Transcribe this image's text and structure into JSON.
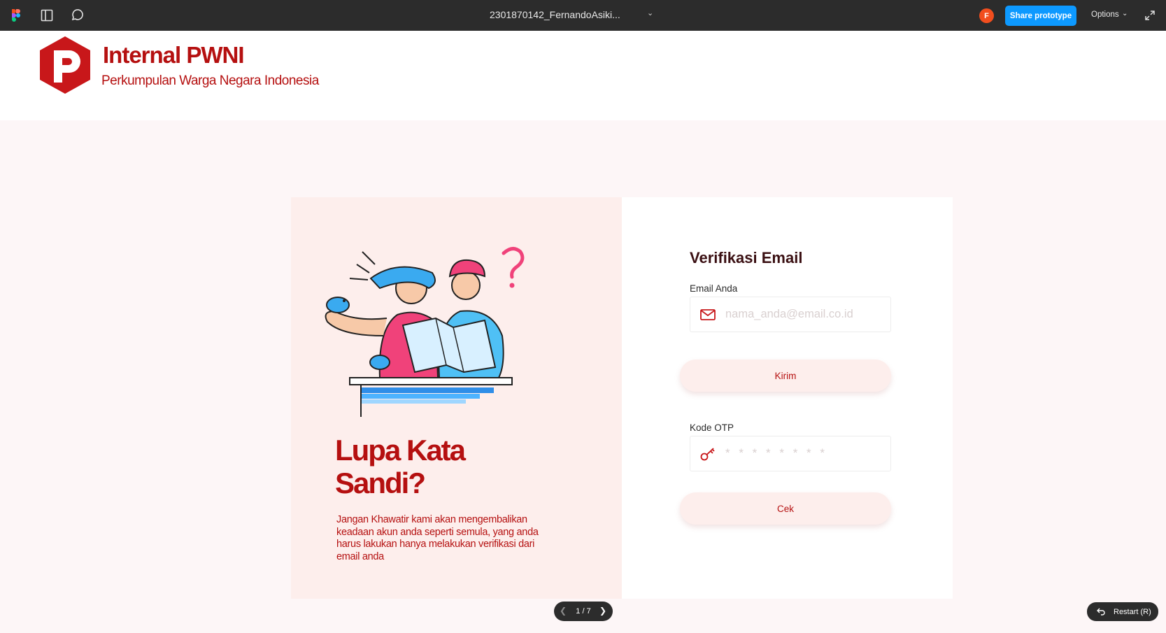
{
  "topbar": {
    "file_title": "2301870142_FernandoAsiki...",
    "avatar_initial": "F",
    "share_label": "Share prototype",
    "options_label": "Options",
    "bg_color": "#2c2c2c",
    "share_color": "#0d99ff"
  },
  "header": {
    "brand_title": "Internal PWNI",
    "brand_subtitle": "Perkumpulan Warga Negara Indonesia",
    "brand_color": "#b51010"
  },
  "left_panel": {
    "title": "Lupa Kata Sandi?",
    "description": "Jangan Khawatir kami akan mengembalikan keadaan akun anda seperti semula, yang anda harus lakukan hanya melakukan verifikasi dari email anda"
  },
  "form": {
    "title": "Verifikasi Email",
    "email_label": "Email Anda",
    "email_placeholder": "nama_anda@email.co.id",
    "email_value": "",
    "send_label": "Kirim",
    "otp_label": "Kode OTP",
    "otp_placeholder": "* * * * * * * *",
    "otp_value": "",
    "check_label": "Cek"
  },
  "pager": {
    "count": "1 / 7"
  },
  "restart": {
    "label": "Restart (R)"
  },
  "icons": {
    "figma": "figma-logo-icon",
    "panel": "panel-icon",
    "comment": "comment-icon",
    "email": "mail-icon",
    "otp": "key-icon",
    "restart": "undo-icon"
  }
}
